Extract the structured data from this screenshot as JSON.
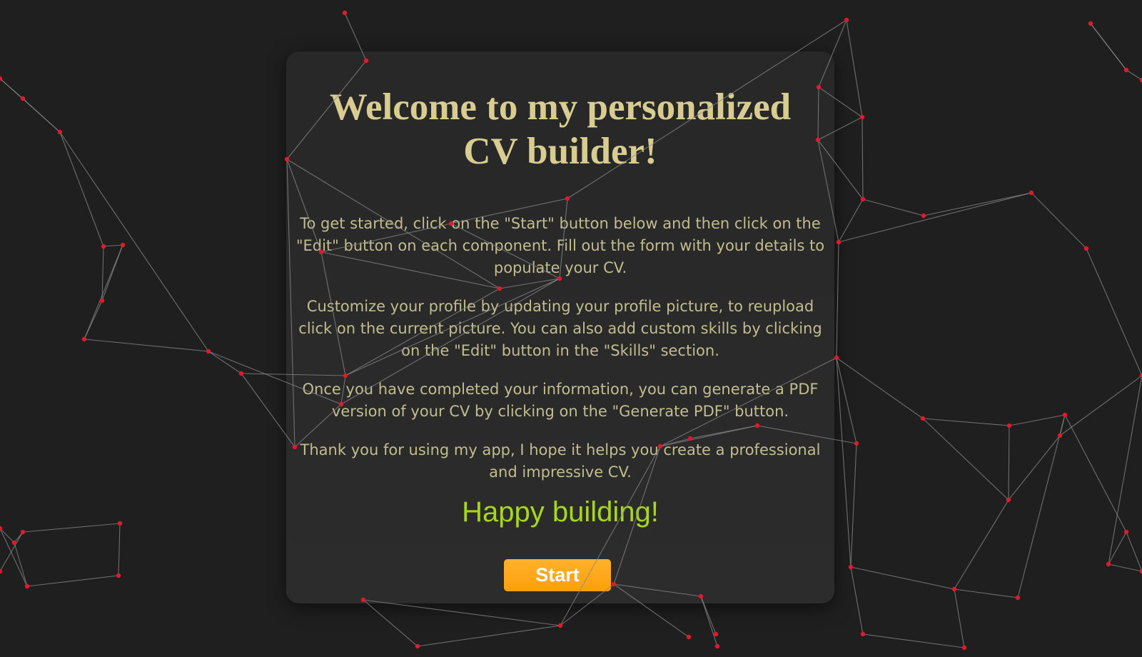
{
  "welcome": {
    "title": "Welcome to my personalized CV builder!",
    "paragraphs": [
      "To get started, click on the \"Start\" button below and then click on the \"Edit\" button on each component. Fill out the form with your details to populate your CV.",
      "Customize your profile by updating your profile picture, to reupload click on the current picture. You can also add custom skills by clicking on the \"Edit\" button in the \"Skills\" section.",
      "Once you have completed your information, you can generate a PDF version of your CV by clicking on the \"Generate PDF\" button.",
      "Thank you for using my app, I hope it helps you create a professional and impressive CV."
    ],
    "happy": "Happy building!",
    "start_label": "Start"
  },
  "colors": {
    "background": "#1f1f1f",
    "title": "#d8cc90",
    "body_text": "#c2bd8e",
    "happy": "#a7d61f",
    "button": "#ffa51a",
    "node": "#e0192c",
    "line": "#8a8a8a"
  }
}
